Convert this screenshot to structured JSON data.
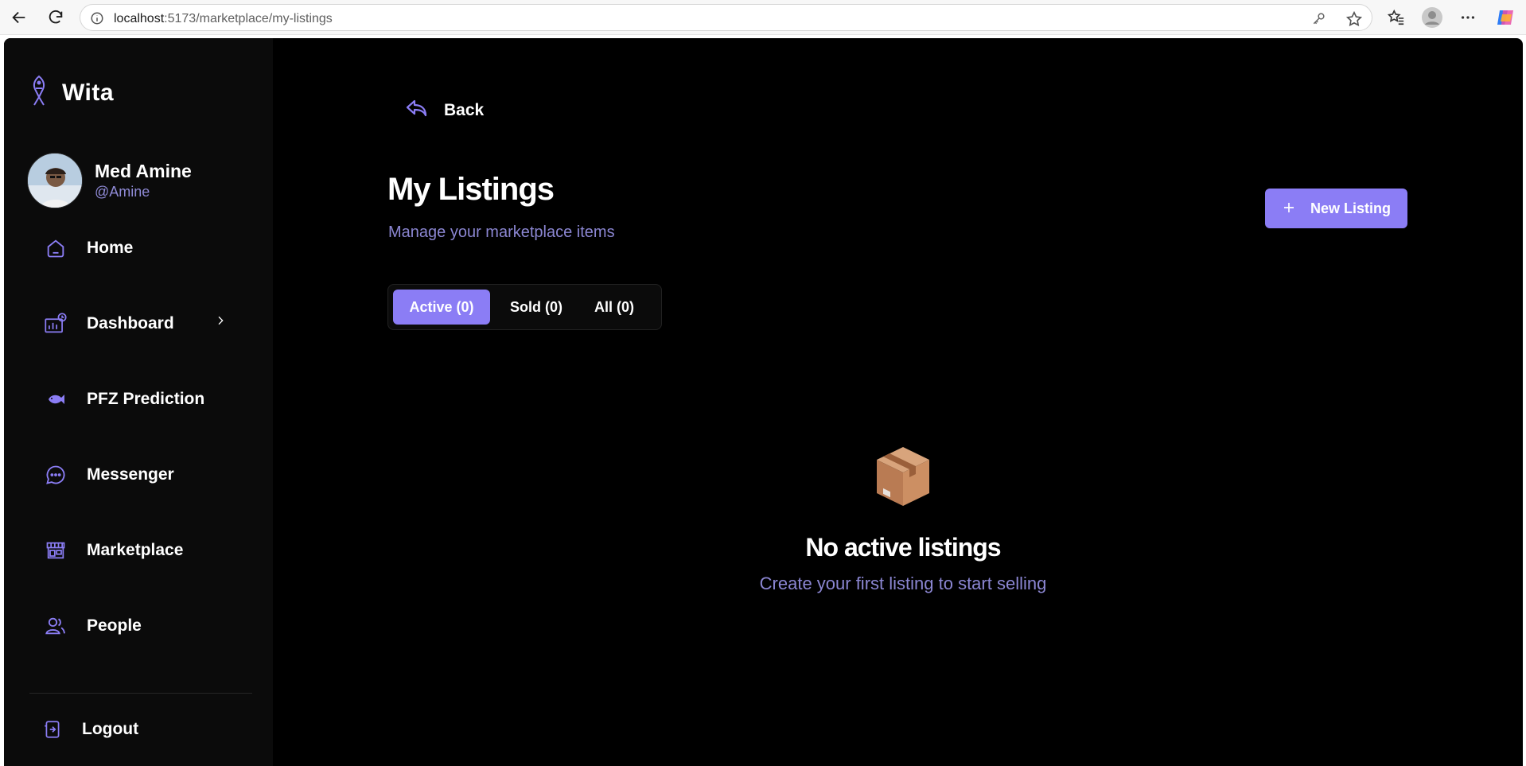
{
  "browser": {
    "url_host": "localhost",
    "url_path": ":5173/marketplace/my-listings",
    "icons": [
      "back-arrow-icon",
      "reload-icon",
      "info-icon",
      "key-icon",
      "star-icon",
      "favorites-icon",
      "profile-icon",
      "more-icon",
      "copilot-icon"
    ]
  },
  "sidebar": {
    "brand": "Wita",
    "user": {
      "name": "Med Amine",
      "handle": "@Amine"
    },
    "items": [
      {
        "label": "Home",
        "icon": "home-icon"
      },
      {
        "label": "Dashboard",
        "icon": "dashboard-icon"
      },
      {
        "label": "PFZ Prediction",
        "icon": "fish-icon"
      },
      {
        "label": "Messenger",
        "icon": "chat-icon"
      },
      {
        "label": "Marketplace",
        "icon": "store-icon"
      },
      {
        "label": "People",
        "icon": "people-icon"
      }
    ],
    "logout": "Logout"
  },
  "main": {
    "back": "Back",
    "title": "My Listings",
    "subtitle": "Manage your marketplace items",
    "new_listing": "New Listing",
    "tabs": [
      {
        "label": "Active (0)",
        "active": true
      },
      {
        "label": "Sold (0)",
        "active": false
      },
      {
        "label": "All (0)",
        "active": false
      }
    ],
    "empty": {
      "title": "No active listings",
      "text": "Create your first listing to start selling",
      "icon": "package-icon"
    }
  },
  "colors": {
    "accent": "#8b7df5",
    "muted_text": "#8b86d2",
    "background": "#000000",
    "sidebar": "#0b0b0b"
  }
}
